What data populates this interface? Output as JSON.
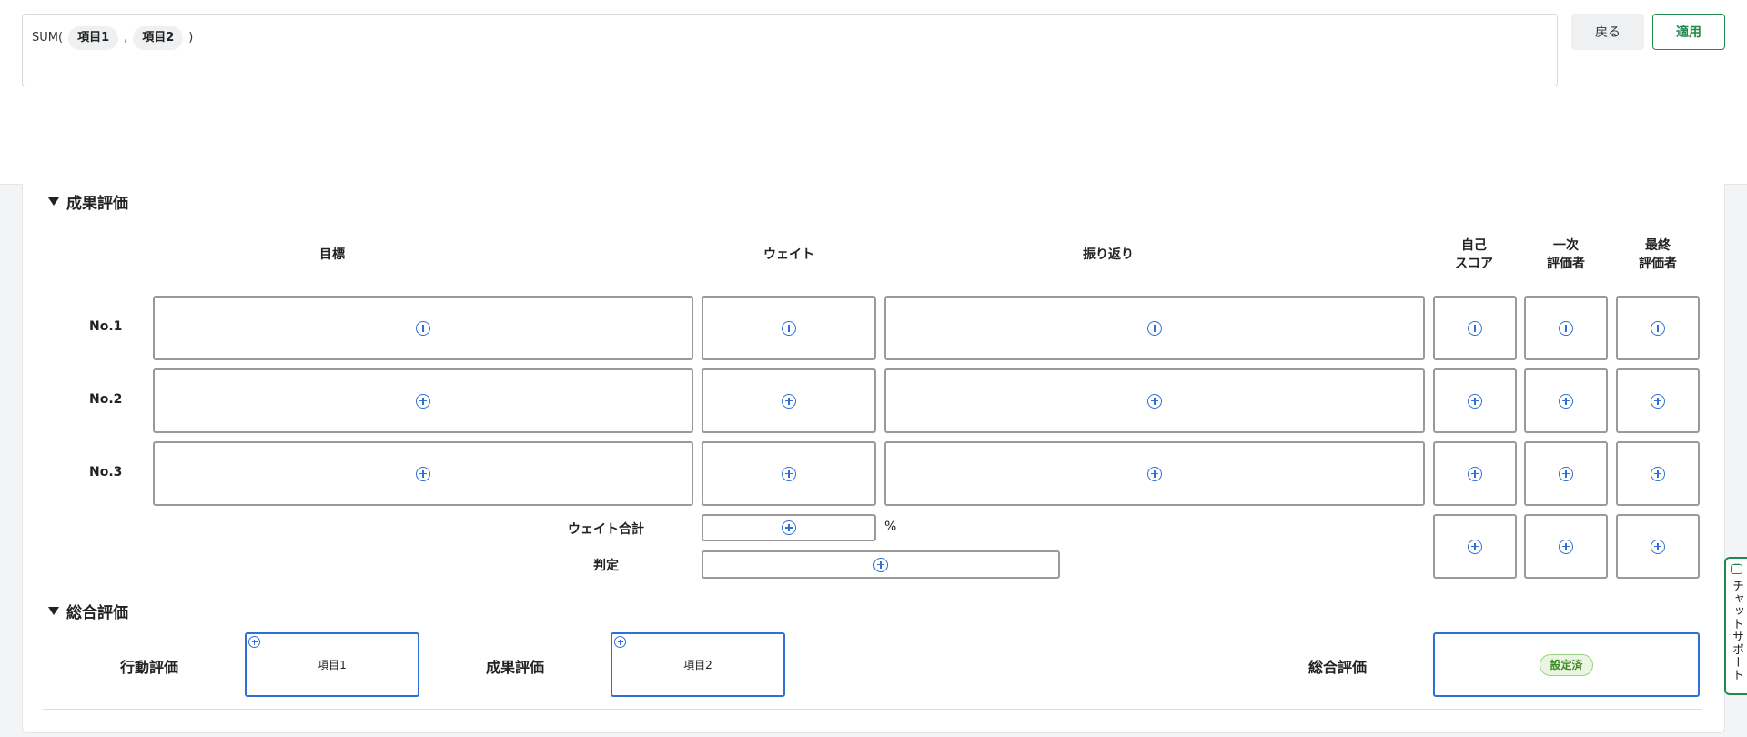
{
  "formula": {
    "prefix": "SUM(",
    "arg1": "項目1",
    "separator": ",",
    "arg2": "項目2",
    "suffix": ")"
  },
  "toolbar": {
    "back_label": "戻る",
    "apply_label": "適用"
  },
  "results_section": {
    "title": "成果評価",
    "headers": {
      "goal": "目標",
      "weight": "ウェイト",
      "reflection": "振り返り",
      "self_score_1": "自己",
      "self_score_2": "スコア",
      "first_1": "一次",
      "first_2": "評価者",
      "final_1": "最終",
      "final_2": "評価者"
    },
    "rows": [
      {
        "label": "No.1"
      },
      {
        "label": "No.2"
      },
      {
        "label": "No.3"
      }
    ],
    "weight_total_label": "ウェイト合計",
    "weight_unit": "%",
    "judgement_label": "判定"
  },
  "overall_section": {
    "title": "総合評価",
    "behavior_label": "行動評価",
    "behavior_value": "項目1",
    "results_label": "成果評価",
    "results_value": "項目2",
    "overall_label": "総合評価",
    "overall_badge": "設定済"
  },
  "chat": {
    "label": "チャットサポート"
  },
  "colors": {
    "accent_blue": "#2f6fd6",
    "apply_green": "#1f8a4c",
    "badge_green": "#3d8a24",
    "cell_border": "#9a9a9a"
  }
}
